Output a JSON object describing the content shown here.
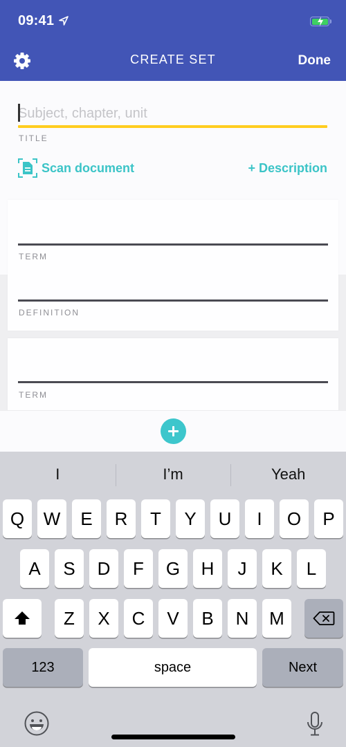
{
  "status_bar": {
    "time": "09:41",
    "location_icon": "location-arrow-icon",
    "battery_icon": "battery-charging-icon"
  },
  "nav": {
    "settings_icon": "gear-icon",
    "title": "CREATE SET",
    "done_label": "Done"
  },
  "colors": {
    "header": "#4255b6",
    "accent_teal": "#3bc4c7",
    "title_underline": "#ffcd1f",
    "keyboard_bg": "#d2d3d9"
  },
  "title_field": {
    "value": "",
    "placeholder": "Subject, chapter, unit",
    "label": "TITLE"
  },
  "actions": {
    "scan_label": "Scan document",
    "scan_icon": "scan-document-icon",
    "description_label": "+ Description"
  },
  "cards": [
    {
      "term_value": "",
      "term_label": "TERM",
      "definition_value": "",
      "definition_label": "DEFINITION"
    },
    {
      "term_value": "",
      "term_label": "TERM"
    }
  ],
  "add_button_icon": "plus-icon",
  "keyboard": {
    "suggestions": [
      "I",
      "I’m",
      "Yeah"
    ],
    "row1": [
      "Q",
      "W",
      "E",
      "R",
      "T",
      "Y",
      "U",
      "I",
      "O",
      "P"
    ],
    "row2": [
      "A",
      "S",
      "D",
      "F",
      "G",
      "H",
      "J",
      "K",
      "L"
    ],
    "row3": [
      "Z",
      "X",
      "C",
      "V",
      "B",
      "N",
      "M"
    ],
    "shift_icon": "shift-icon",
    "backspace_icon": "backspace-icon",
    "numbers_label": "123",
    "space_label": "space",
    "return_label": "Next",
    "emoji_icon": "emoji-icon",
    "mic_icon": "microphone-icon"
  }
}
